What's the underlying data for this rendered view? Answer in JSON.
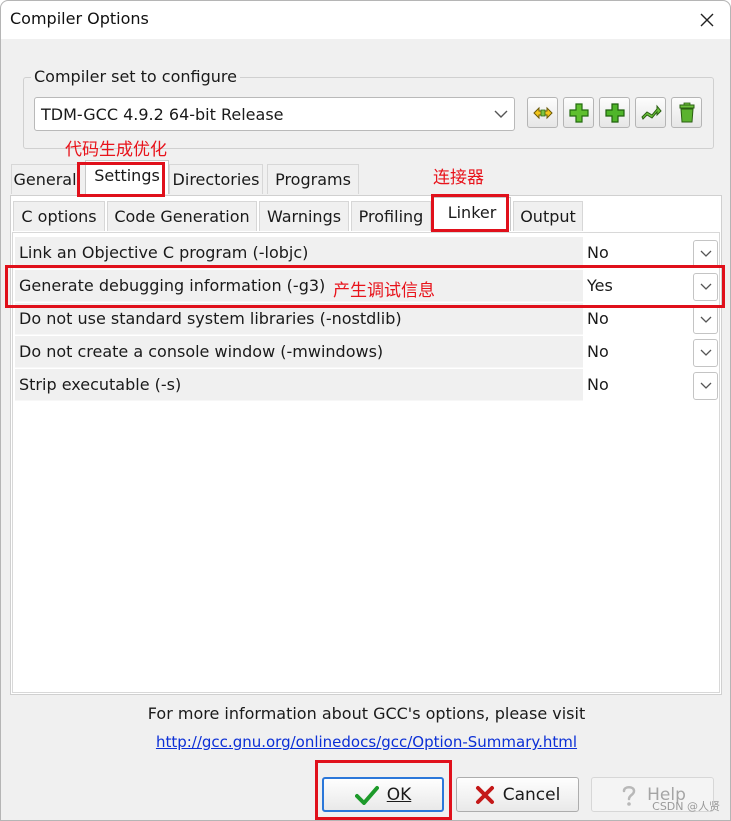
{
  "window": {
    "title": "Compiler Options"
  },
  "compiler_set": {
    "legend": "Compiler set to configure",
    "selected": "TDM-GCC 4.9.2 64-bit Release"
  },
  "toolbar_icons": [
    "compiler-set-find-icon",
    "add-compiler-set-icon",
    "add-compiler-set-folder-icon",
    "rename-compiler-set-icon",
    "delete-compiler-set-icon"
  ],
  "main_tabs": [
    {
      "label": "General",
      "active": false
    },
    {
      "label": "Settings",
      "active": true
    },
    {
      "label": "Directories",
      "active": false
    },
    {
      "label": "Programs",
      "active": false
    }
  ],
  "sub_tabs": [
    {
      "label": "C options",
      "active": false
    },
    {
      "label": "Code Generation",
      "active": false
    },
    {
      "label": "Warnings",
      "active": false
    },
    {
      "label": "Profiling",
      "active": false
    },
    {
      "label": "Linker",
      "active": true
    },
    {
      "label": "Output",
      "active": false
    }
  ],
  "options": [
    {
      "label": "Link an Objective C program (-lobjc)",
      "value": "No"
    },
    {
      "label": "Generate debugging information (-g3)",
      "value": "Yes"
    },
    {
      "label": "Do not use standard system libraries (-nostdlib)",
      "value": "No"
    },
    {
      "label": "Do not create a console window (-mwindows)",
      "value": "No"
    },
    {
      "label": "Strip executable (-s)",
      "value": "No"
    }
  ],
  "annotations": {
    "settings_note": "代码生成优化",
    "linker_note": "连接器",
    "debug_note": "产生调试信息",
    "color": "#e0101b"
  },
  "info": {
    "text": "For more information about GCC's options, please visit",
    "link": "http://gcc.gnu.org/onlinedocs/gcc/Option-Summary.html"
  },
  "buttons": {
    "ok": "OK",
    "cancel": "Cancel",
    "help": "Help"
  },
  "watermark": "CSDN @人贤"
}
